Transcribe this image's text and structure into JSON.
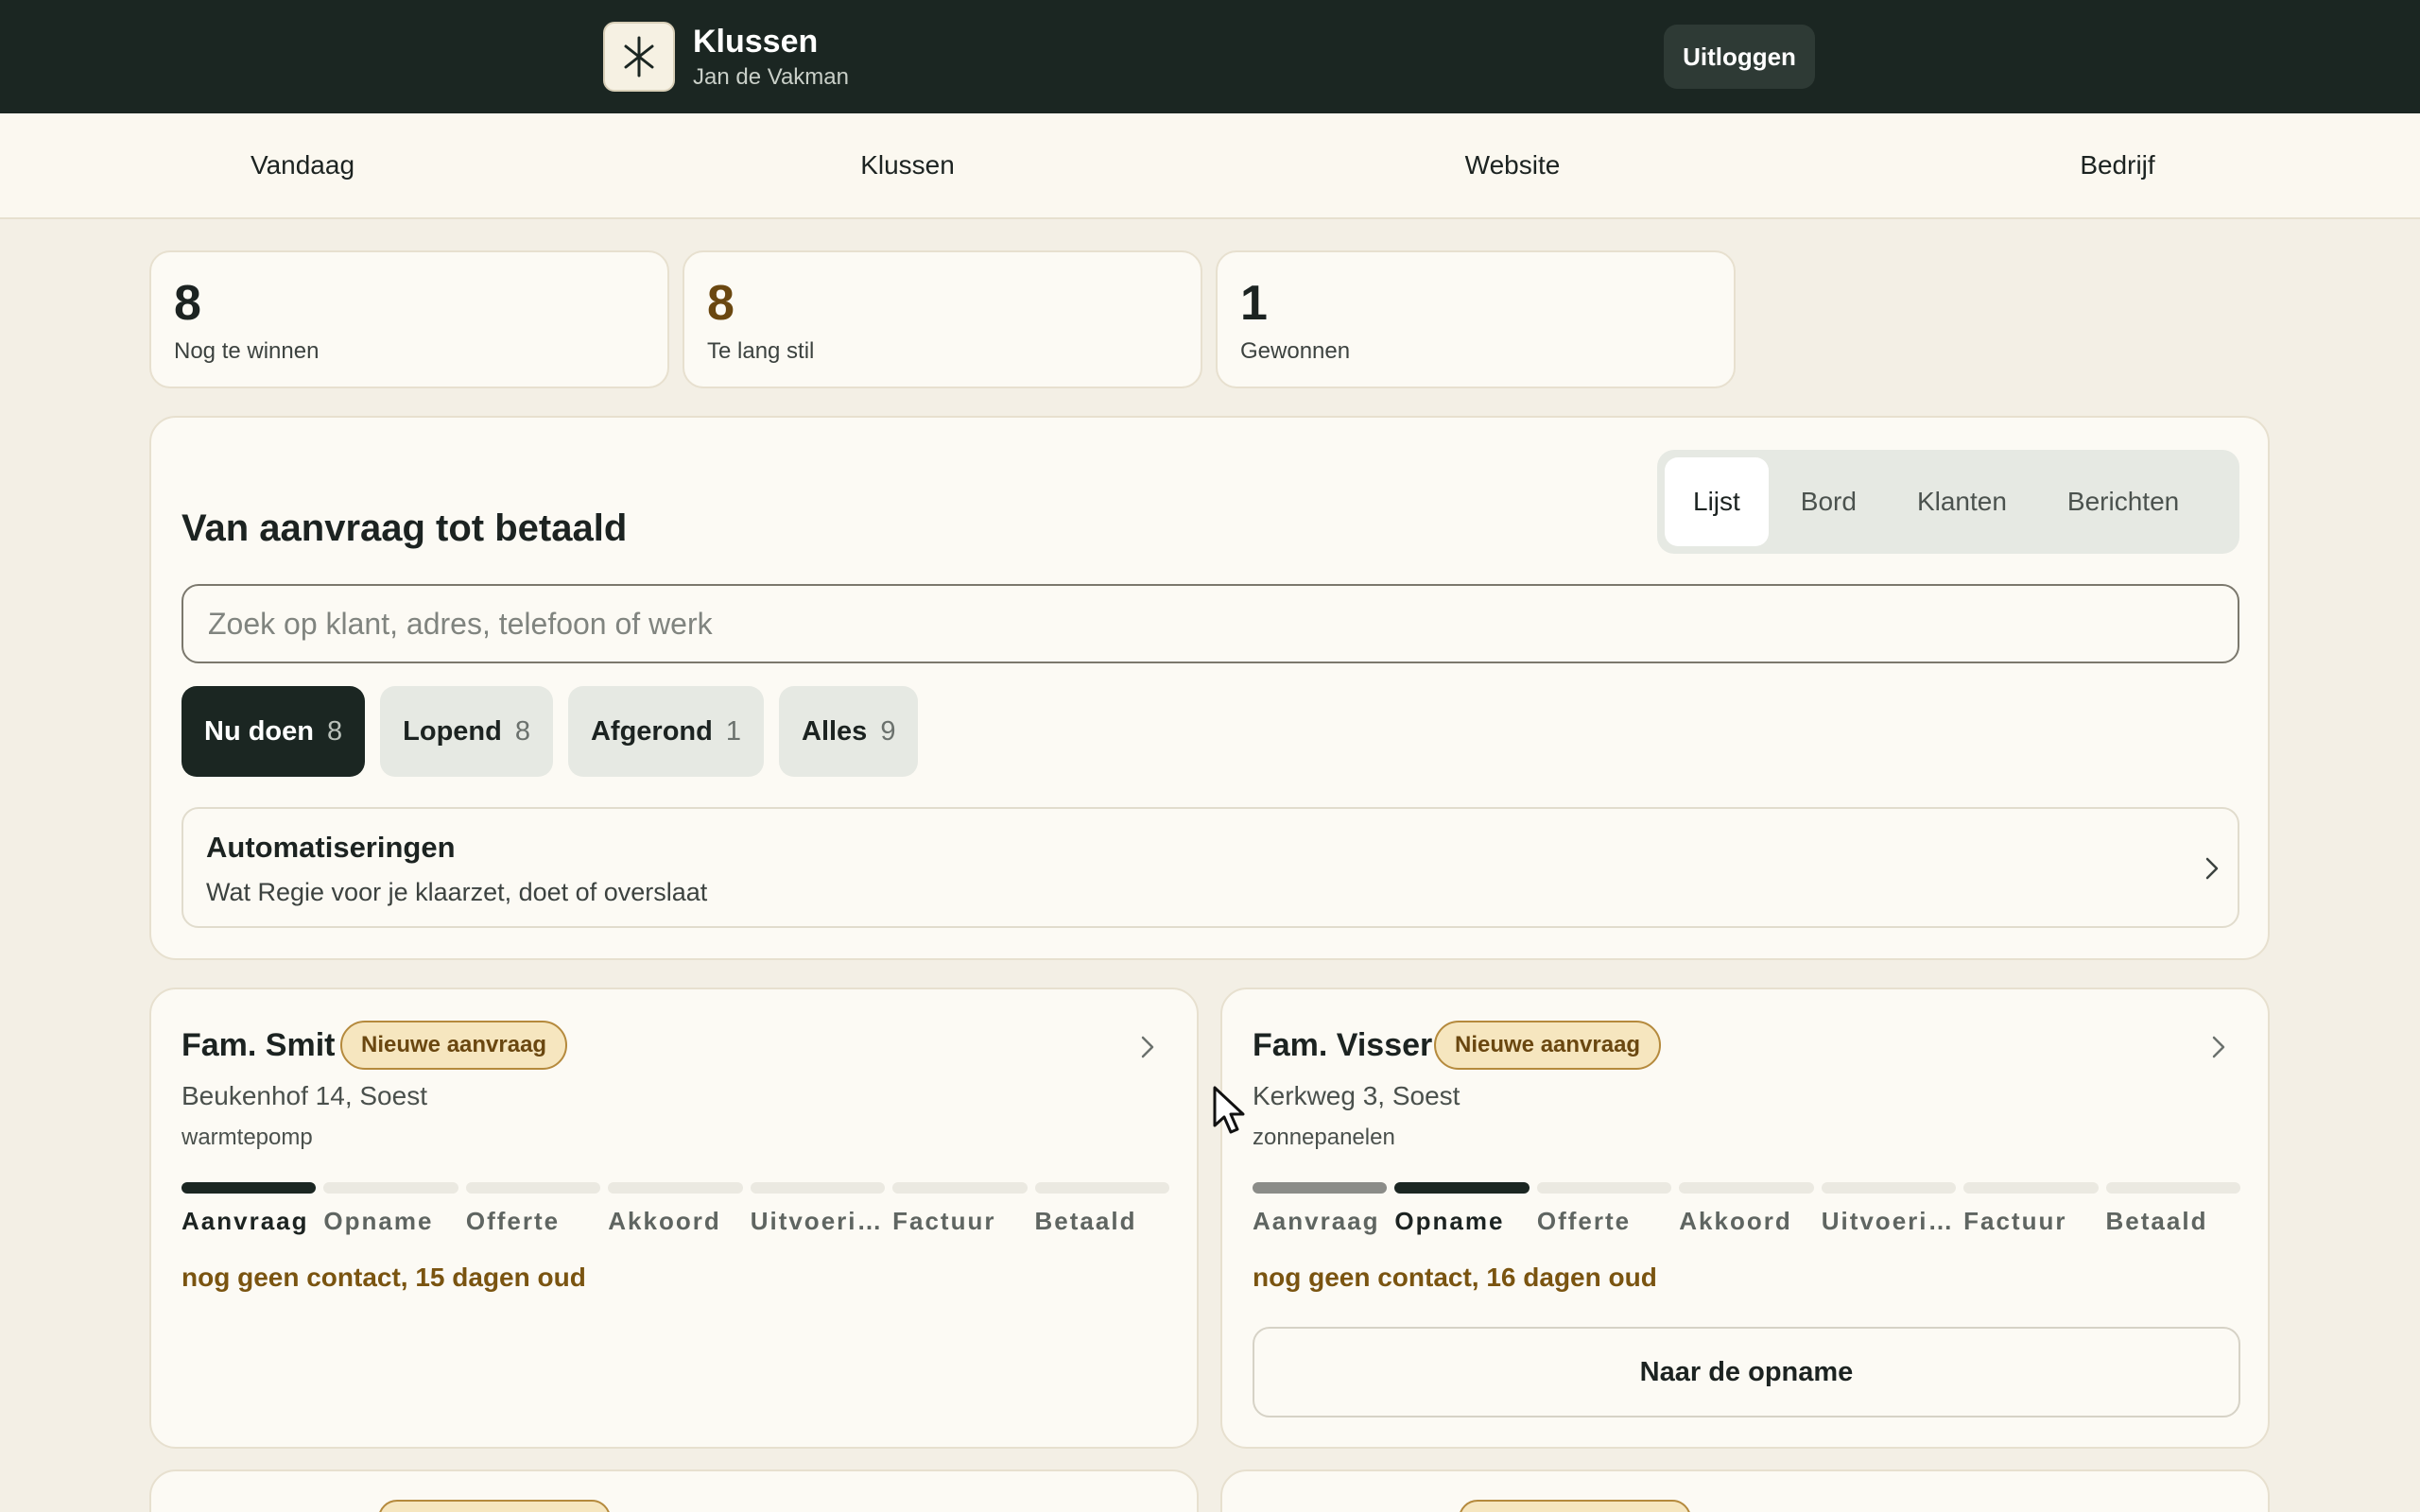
{
  "header": {
    "app_title": "Klussen",
    "user_name": "Jan de Vakman",
    "logout_label": "Uitloggen",
    "logo_icon": "asterisk-icon"
  },
  "nav": {
    "items": [
      {
        "label": "Vandaag"
      },
      {
        "label": "Klussen"
      },
      {
        "label": "Website"
      },
      {
        "label": "Bedrijf"
      }
    ]
  },
  "stats": [
    {
      "value": "8",
      "label": "Nog te winnen",
      "color": "#1c2321"
    },
    {
      "value": "8",
      "label": "Te lang stil",
      "color": "#6a4710"
    },
    {
      "value": "1",
      "label": "Gewonnen",
      "color": "#1c2321"
    }
  ],
  "panel": {
    "title": "Van aanvraag tot betaald",
    "views": [
      {
        "label": "Lijst",
        "active": true
      },
      {
        "label": "Bord",
        "active": false
      },
      {
        "label": "Klanten",
        "active": false
      },
      {
        "label": "Berichten",
        "active": false
      }
    ],
    "search": {
      "placeholder": "Zoek op klant, adres, telefoon of werk",
      "value": ""
    },
    "filters": [
      {
        "label": "Nu doen",
        "count": "8",
        "active": true
      },
      {
        "label": "Lopend",
        "count": "8",
        "active": false
      },
      {
        "label": "Afgerond",
        "count": "1",
        "active": false
      },
      {
        "label": "Alles",
        "count": "9",
        "active": false
      }
    ],
    "automations": {
      "title": "Automatiseringen",
      "subtitle": "Wat Regie voor je klaarzet, doet of overslaat"
    }
  },
  "stage_labels": [
    "Aanvraag",
    "Opname",
    "Offerte",
    "Akkoord",
    "Uitvoeri…",
    "Factuur",
    "Betaald"
  ],
  "jobs": [
    {
      "name": "Fam. Smit",
      "badge": "Nieuwe aanvraag",
      "address": "Beukenhof 14, Soest",
      "work": "warmtepomp",
      "current_stage": 0,
      "alert": "nog geen contact, 15 dagen oud",
      "action": ""
    },
    {
      "name": "Fam. Visser",
      "badge": "Nieuwe aanvraag",
      "address": "Kerkweg 3, Soest",
      "work": "zonnepanelen",
      "current_stage": 1,
      "alert": "nog geen contact, 16 dagen oud",
      "action": "Naar de opname"
    }
  ]
}
